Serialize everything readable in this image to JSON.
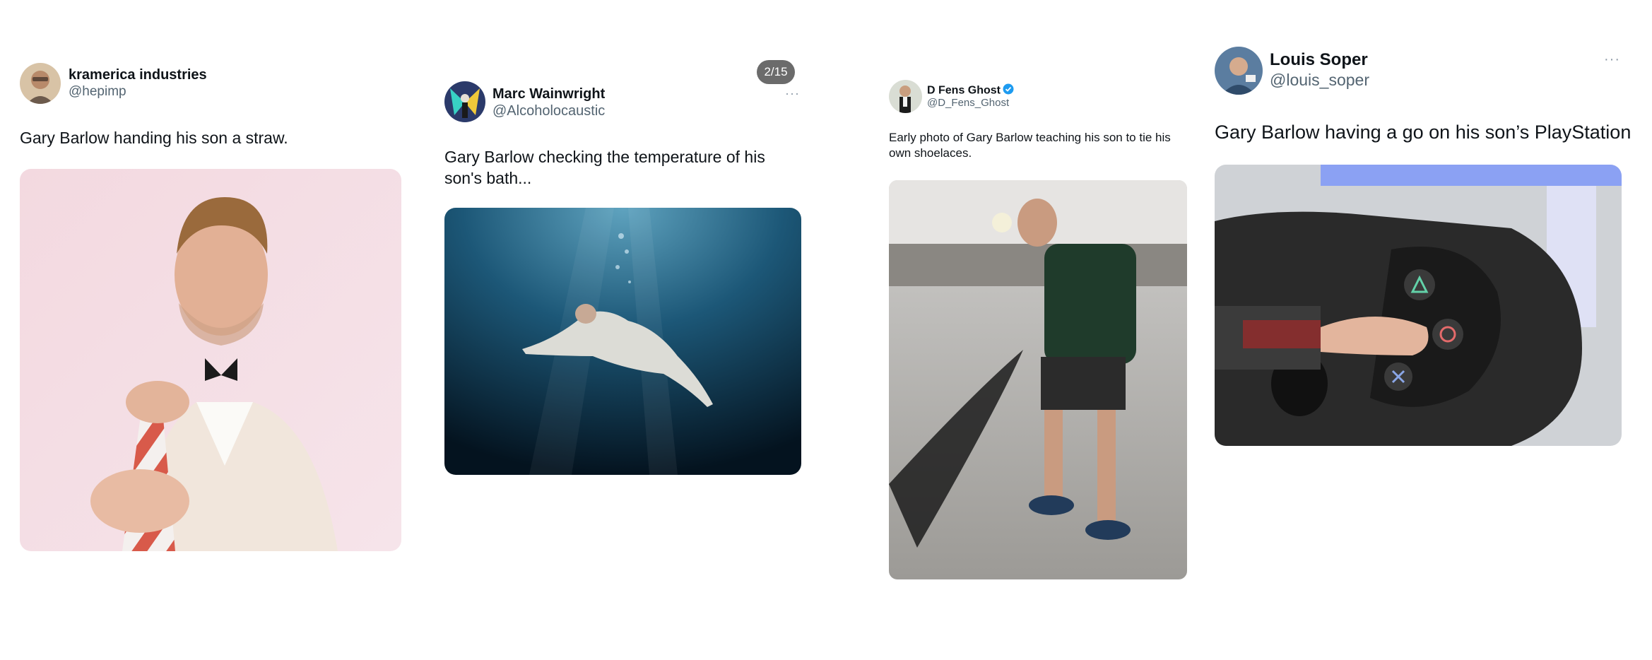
{
  "tweets": [
    {
      "name": "kramerica industries",
      "handle": "@hepimp",
      "text": "Gary Barlow handing his son a straw."
    },
    {
      "name": "Marc Wainwright",
      "handle": "@Alcoholocaustic",
      "text": "Gary Barlow checking the temperature of his son's bath...",
      "counter": "2/15",
      "more": "···"
    },
    {
      "name": "D Fens Ghost",
      "handle": "@D_Fens_Ghost",
      "text": "Early photo of Gary Barlow teaching his son to tie his own shoelaces.",
      "verified": true
    },
    {
      "name": "Louis Soper",
      "handle": "@louis_soper",
      "text": "Gary Barlow having a go on his son’s PlayStation",
      "more": "···"
    }
  ],
  "icons": {
    "verified": "verified-badge-icon",
    "more": "more-options-icon"
  },
  "colors": {
    "handle": "#536471",
    "verified": "#1d9bf0",
    "counter_bg": "#6b6b6b"
  }
}
